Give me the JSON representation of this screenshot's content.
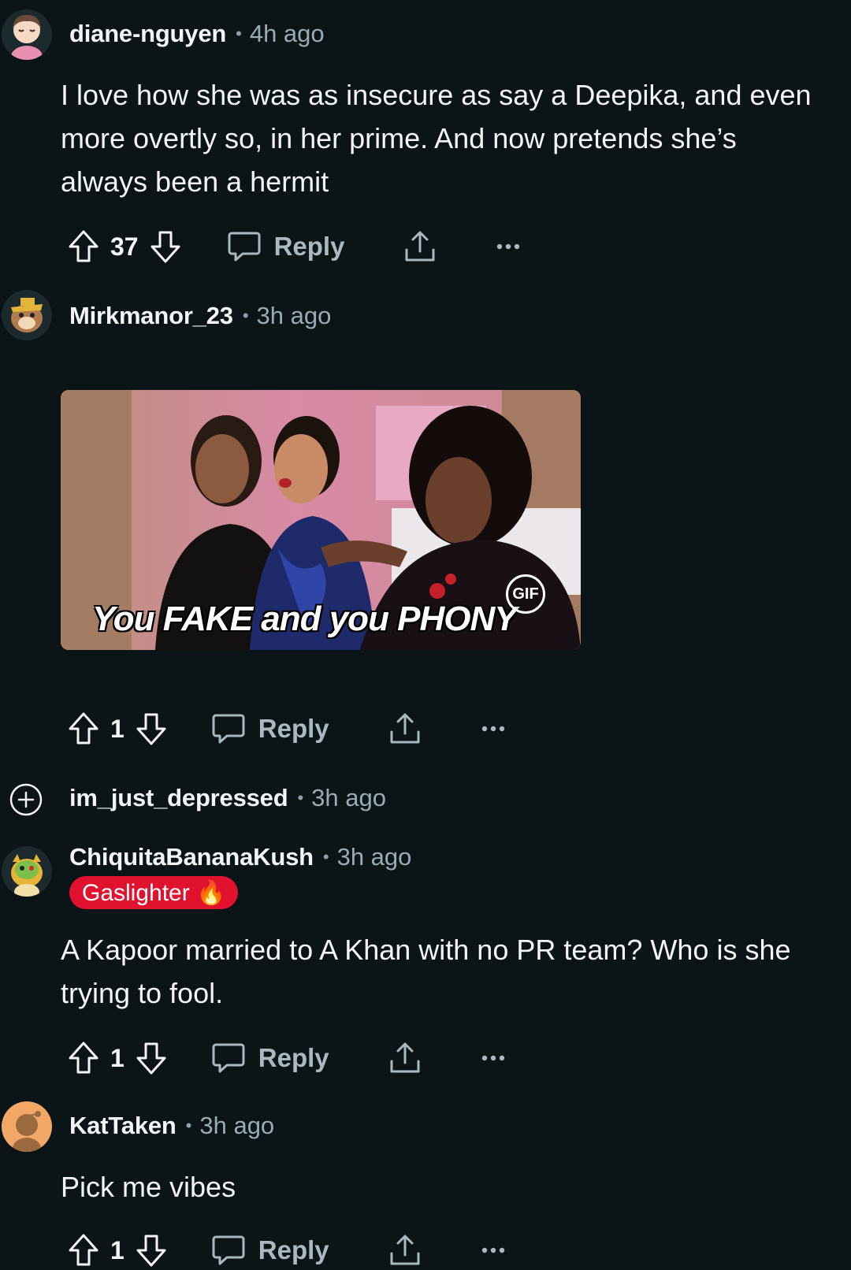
{
  "comments": [
    {
      "username": "diane-nguyen",
      "time": "4h ago",
      "text": "I love how she was as insecure as say a Deepika, and even more overtly so, in her prime. And now pretends she’s always been a hermit",
      "score": "37",
      "reply_label": "Reply"
    },
    {
      "username": "Mirkmanor_23",
      "time": "3h ago",
      "gif_caption": "You FAKE and you PHONY",
      "gif_badge": "GIF",
      "score": "1",
      "reply_label": "Reply"
    },
    {
      "username": "im_just_depressed",
      "time": "3h ago",
      "collapsed": true
    },
    {
      "username": "ChiquitaBananaKush",
      "time": "3h ago",
      "flair": "Gaslighter 🔥",
      "text": "A Kapoor married to A Khan with no PR team? Who is she trying to fool.",
      "score": "1",
      "reply_label": "Reply"
    },
    {
      "username": "KatTaken",
      "time": "3h ago",
      "text": "Pick me vibes",
      "score": "1",
      "reply_label": "Reply"
    }
  ],
  "separator": "•",
  "colors": {
    "background": "#0b1416",
    "text": "#f2f4f5",
    "muted": "#9aabb3",
    "flair_bg": "#e0122e"
  }
}
